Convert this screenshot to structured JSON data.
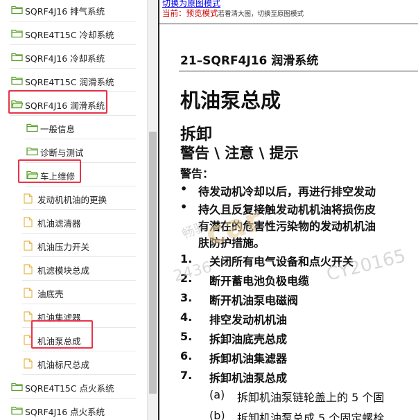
{
  "tree": {
    "items": [
      {
        "label": "SQRF4J16 排气系统",
        "icon": "folder-icon"
      },
      {
        "label": "SQRE4T15C 冷却系统",
        "icon": "folder-icon"
      },
      {
        "label": "SQRF4J16 冷却系统",
        "icon": "folder-icon"
      },
      {
        "label": "SQRE4T15C 润滑系统",
        "icon": "folder-icon"
      },
      {
        "label": "SQRF4J16 润滑系统",
        "icon": "folder-open-icon"
      },
      {
        "label": "一般信息",
        "icon": "folder-icon"
      },
      {
        "label": "诊断与测试",
        "icon": "folder-icon"
      },
      {
        "label": "车上维修",
        "icon": "folder-open-icon"
      },
      {
        "label": "发动机机油的更换",
        "icon": "document-icon"
      },
      {
        "label": "机油滤清器",
        "icon": "document-icon"
      },
      {
        "label": "机油压力开关",
        "icon": "document-icon"
      },
      {
        "label": "机滤模块总成",
        "icon": "document-icon"
      },
      {
        "label": "油底壳",
        "icon": "document-icon"
      },
      {
        "label": "机油集滤器",
        "icon": "document-icon"
      },
      {
        "label": "机油泵总成",
        "icon": "document-icon"
      },
      {
        "label": "机油标尺总成",
        "icon": "document-icon"
      },
      {
        "label": "SQRE4T15C 点火系统",
        "icon": "folder-icon"
      },
      {
        "label": "SQRF4J16 点火系统",
        "icon": "folder-icon"
      }
    ]
  },
  "doc": {
    "switch_link": "切换为原图模式",
    "mode_label": "当前：",
    "mode_name": "预览模式",
    "mode_hint": "若看清大图，切换至原图模式",
    "section_header": "21–SQRF4J16 润滑系统",
    "title": "机油泵总成",
    "subtitle": "拆卸",
    "warning_heading": "警告 \\ 注意 \\ 提示",
    "warning_label": "警告：",
    "bullets": [
      {
        "dot": "•",
        "text": "待发动机冷却以后，再进行排空发动"
      },
      {
        "dot": "•",
        "text": "持久且反复接触发动机机油将损伤皮"
      }
    ],
    "bullet_continuation": [
      "有潜在的危害性污染物的发动机机油",
      "肤防护措施。"
    ],
    "steps": [
      {
        "num": "1.",
        "text": "关闭所有电气设备和点火开关"
      },
      {
        "num": "2.",
        "text": "断开蓄电池负极电缆"
      },
      {
        "num": "3.",
        "text": "断开机油泵电磁阀"
      },
      {
        "num": "4.",
        "text": "排空发动机机油"
      },
      {
        "num": "5.",
        "text": "拆卸油底壳总成"
      },
      {
        "num": "6.",
        "text": "拆卸机油集滤器"
      },
      {
        "num": "7.",
        "text": "拆卸机油泵总成"
      }
    ],
    "substeps": [
      {
        "num": "(a)",
        "text": "拆卸机油泵链轮盖上的 5 个固"
      },
      {
        "num": "(b)",
        "text": "拆卸机油泵总成 5 个固定螺栓"
      }
    ],
    "watermark": {
      "line1": "畅骏",
      "line2": "car",
      "line3": "2436",
      "line4": "CY20165"
    }
  },
  "colors": {
    "highlight": "#e8334a",
    "folder": "#5aa02c",
    "document": "#e8b64c",
    "link": "#0000ee",
    "mode": "#cc0000"
  }
}
